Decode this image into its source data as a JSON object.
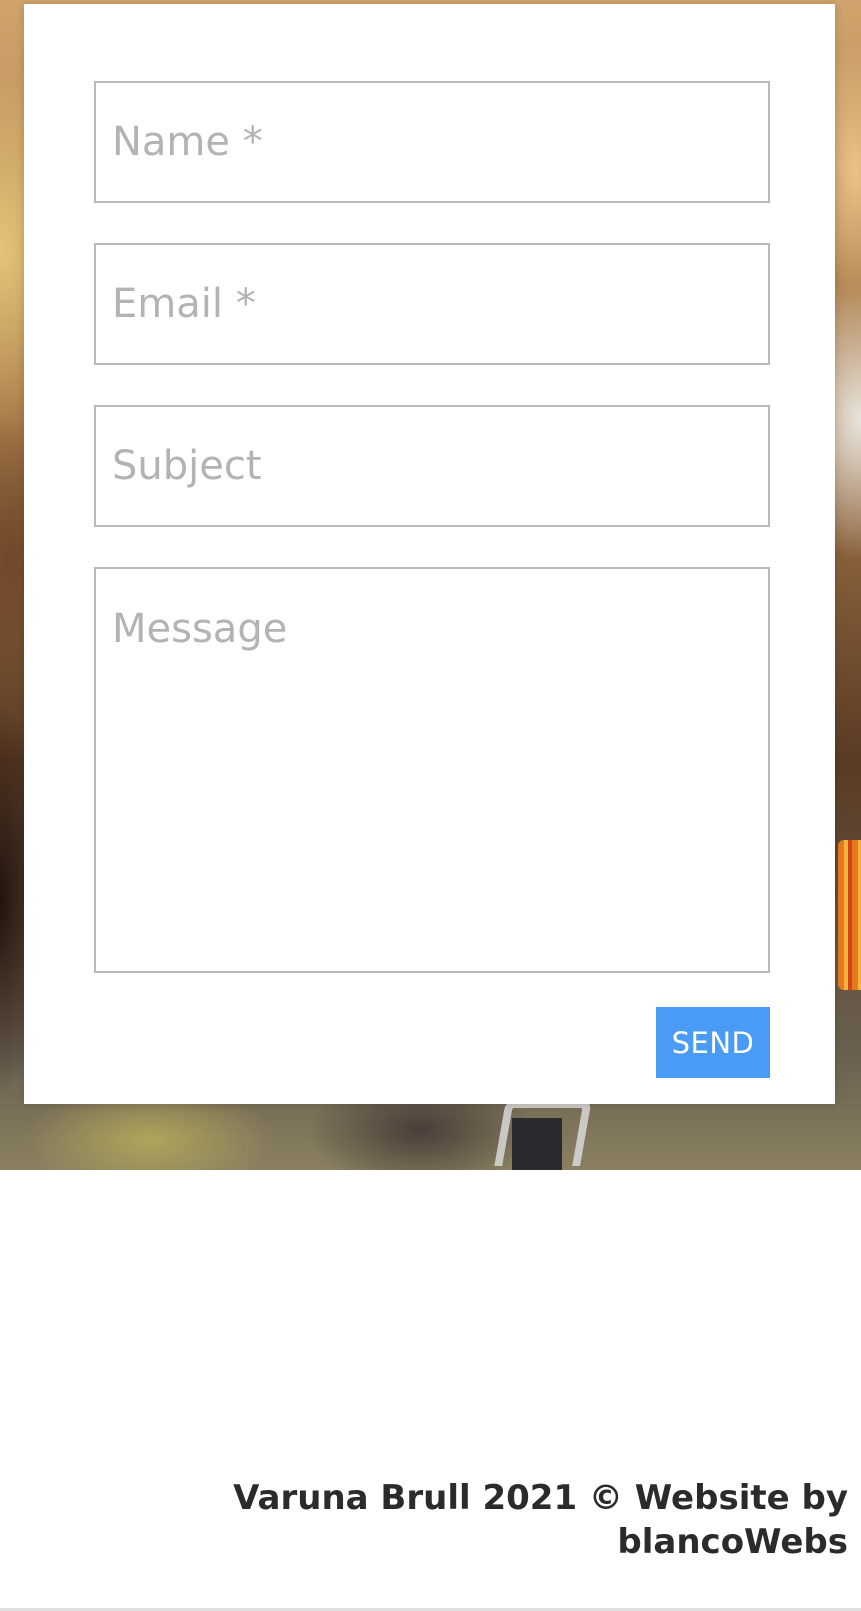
{
  "form": {
    "name_placeholder": "Name *",
    "email_placeholder": "Email *",
    "subject_placeholder": "Subject",
    "message_placeholder": "Message",
    "send_label": "SEND",
    "send_color": "#4a9bf5"
  },
  "footer": {
    "text": "Varuna Brull 2021 © Website by blancoWebs"
  }
}
